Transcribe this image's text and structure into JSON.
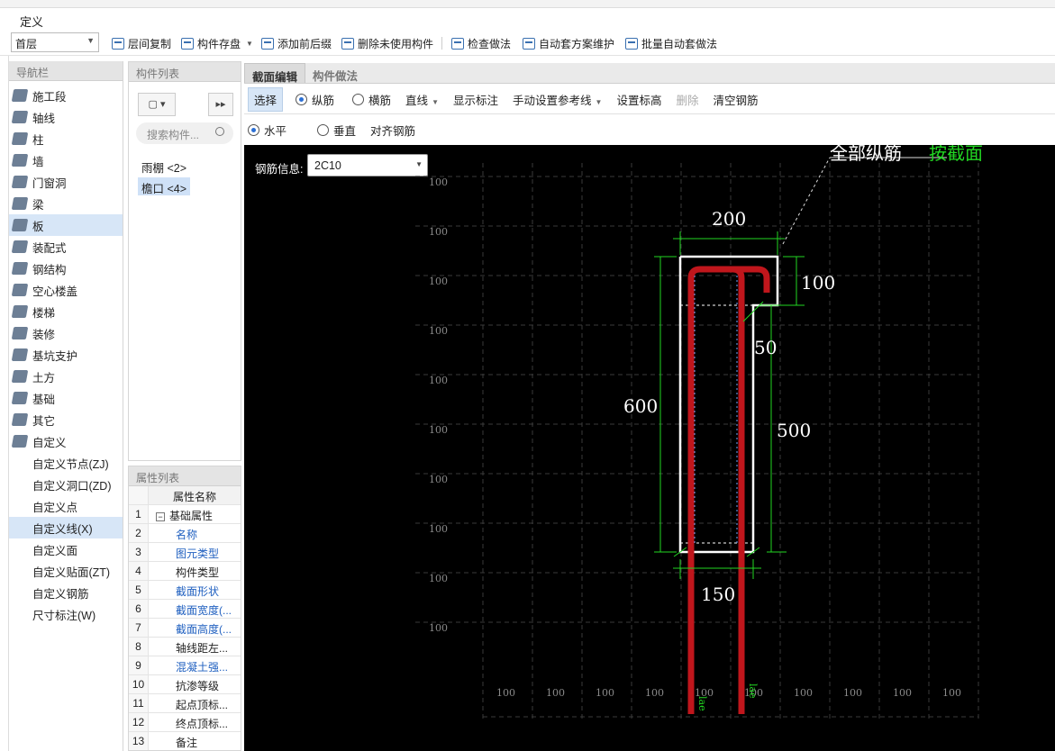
{
  "window": {
    "title": "定义"
  },
  "toolbar": {
    "floor": "首层",
    "items": [
      "层间复制",
      "构件存盘",
      "添加前后缀",
      "删除未使用构件",
      "检查做法",
      "自动套方案维护",
      "批量自动套做法"
    ]
  },
  "nav": {
    "header": "导航栏",
    "items": [
      "施工段",
      "轴线",
      "柱",
      "墙",
      "门窗洞",
      "梁",
      "板",
      "装配式",
      "钢结构",
      "空心楼盖",
      "楼梯",
      "装修",
      "基坑支护",
      "土方",
      "基础",
      "其它",
      "自定义"
    ],
    "subitems": [
      "自定义节点(ZJ)",
      "自定义洞口(ZD)",
      "自定义点",
      "自定义线(X)",
      "自定义面",
      "自定义贴面(ZT)",
      "自定义钢筋",
      "尺寸标注(W)"
    ]
  },
  "components": {
    "header": "构件列表",
    "search_placeholder": "搜索构件...",
    "items": [
      "雨棚 <2>",
      "檐口 <4>"
    ]
  },
  "properties": {
    "header": "属性列表",
    "column": "属性名称",
    "rows": [
      {
        "n": "1",
        "name": "基础属性"
      },
      {
        "n": "2",
        "name": "名称"
      },
      {
        "n": "3",
        "name": "图元类型"
      },
      {
        "n": "4",
        "name": "构件类型"
      },
      {
        "n": "5",
        "name": "截面形状"
      },
      {
        "n": "6",
        "name": "截面宽度(..."
      },
      {
        "n": "7",
        "name": "截面高度(..."
      },
      {
        "n": "8",
        "name": "轴线距左..."
      },
      {
        "n": "9",
        "name": "混凝土强..."
      },
      {
        "n": "10",
        "name": "抗渗等级"
      },
      {
        "n": "11",
        "name": "起点顶标..."
      },
      {
        "n": "12",
        "name": "终点顶标..."
      },
      {
        "n": "13",
        "name": "备注"
      }
    ]
  },
  "tabs": [
    "截面编辑",
    "构件做法"
  ],
  "edit_toolbar": {
    "select": "选择",
    "longitudinal": "纵筋",
    "transverse": "横筋",
    "line": "直线",
    "show_labels": "显示标注",
    "manual_ref": "手动设置参考线",
    "set_elevation": "设置标高",
    "delete": "删除",
    "clear": "清空钢筋"
  },
  "edit_toolbar2": {
    "horizontal": "水平",
    "vertical": "垂直",
    "align": "对齐钢筋"
  },
  "canvas": {
    "rebar_info_label": "钢筋信息:",
    "rebar_value": "2C10",
    "annotation_white": "全部纵筋",
    "annotation_green": "按截面",
    "dims": {
      "top": "200",
      "right_top": "100",
      "step": "50",
      "left": "600",
      "right": "500",
      "bottom": "150"
    },
    "grid_label": "100",
    "lae": "lae"
  },
  "colors": {
    "rebar": "#c0161c",
    "dim": "#22d622",
    "section": "#ffffff",
    "grid": "#3a3a3a"
  }
}
